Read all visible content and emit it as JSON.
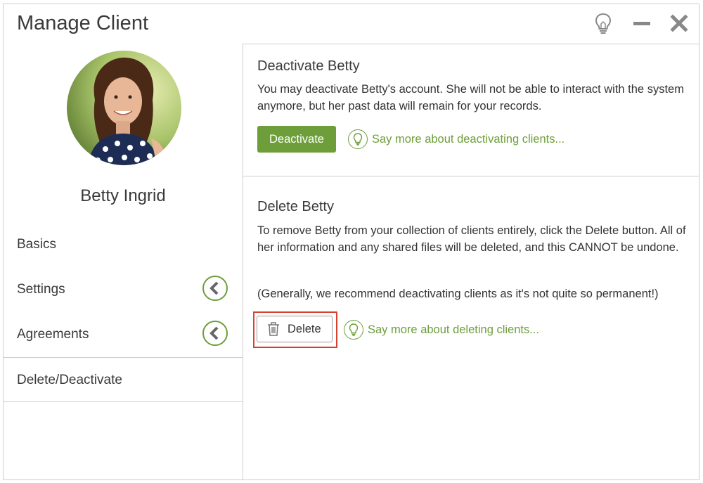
{
  "window": {
    "title": "Manage Client"
  },
  "controls": {
    "help_icon": "lightbulb-icon",
    "minimize_icon": "minimize-icon",
    "close_icon": "close-icon"
  },
  "client": {
    "name": "Betty Ingrid"
  },
  "nav": {
    "items": [
      {
        "label": "Basics",
        "has_arrow": false
      },
      {
        "label": "Settings",
        "has_arrow": true
      },
      {
        "label": "Agreements",
        "has_arrow": true
      },
      {
        "label": "Delete/Deactivate",
        "has_arrow": false,
        "active": true
      }
    ]
  },
  "deactivate": {
    "title": "Deactivate Betty",
    "description": "You may deactivate Betty's account. She will not be able to interact with the system anymore, but her past data will remain for your records.",
    "button_label": "Deactivate",
    "help_link": "Say more about deactivating clients..."
  },
  "delete": {
    "title": "Delete Betty",
    "description": "To remove Betty from your collection of clients entirely, click the Delete button. All of her information and any shared files will be deleted, and this CANNOT be undone.",
    "note": "(Generally, we recommend deactivating clients as it's not quite so permanent!)",
    "button_label": "Delete",
    "help_link": "Say more about deleting clients..."
  },
  "colors": {
    "accent": "#6e9e3a",
    "highlight": "#d9412e",
    "border": "#cfcfcf"
  }
}
